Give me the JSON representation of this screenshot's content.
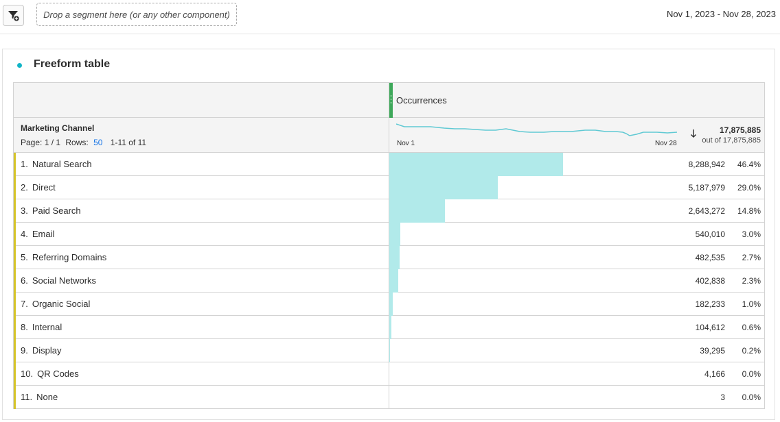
{
  "toolbar": {
    "filter_icon": "segment-filter-add-icon",
    "drop_zone_text": "Drop a segment here (or any other component)",
    "date_range": "Nov 1, 2023 - Nov 28, 2023"
  },
  "panel": {
    "title": "Freeform table",
    "metric": {
      "name": "Occurrences",
      "total": "17,875,885",
      "total_of": "out of 17,875,885",
      "sparkline_start": "Nov 1",
      "sparkline_end": "Nov 28",
      "sort_icon": "sort-descending-icon"
    },
    "dimension": {
      "name": "Marketing Channel",
      "page_label": "Page: 1 / 1",
      "rows_label": "Rows:",
      "rows_value": "50",
      "range": "1-11 of 11"
    },
    "rows": [
      {
        "num": "1.",
        "label": "Natural Search",
        "value": "8,288,942",
        "pct": "46.4%",
        "share": 0.464
      },
      {
        "num": "2.",
        "label": "Direct",
        "value": "5,187,979",
        "pct": "29.0%",
        "share": 0.29
      },
      {
        "num": "3.",
        "label": "Paid Search",
        "value": "2,643,272",
        "pct": "14.8%",
        "share": 0.148
      },
      {
        "num": "4.",
        "label": "Email",
        "value": "540,010",
        "pct": "3.0%",
        "share": 0.03
      },
      {
        "num": "5.",
        "label": "Referring Domains",
        "value": "482,535",
        "pct": "2.7%",
        "share": 0.027
      },
      {
        "num": "6.",
        "label": "Social Networks",
        "value": "402,838",
        "pct": "2.3%",
        "share": 0.023
      },
      {
        "num": "7.",
        "label": "Organic Social",
        "value": "182,233",
        "pct": "1.0%",
        "share": 0.01
      },
      {
        "num": "8.",
        "label": "Internal",
        "value": "104,612",
        "pct": "0.6%",
        "share": 0.006
      },
      {
        "num": "9.",
        "label": "Display",
        "value": "39,295",
        "pct": "0.2%",
        "share": 0.002
      },
      {
        "num": "10.",
        "label": "QR Codes",
        "value": "4,166",
        "pct": "0.0%",
        "share": 0.0002
      },
      {
        "num": "11.",
        "label": "None",
        "value": "3",
        "pct": "0.0%",
        "share": 0.0
      }
    ]
  },
  "colors": {
    "bar": "#b1eaea",
    "row_accent": "#d6c52b",
    "metric_handle": "#3ea85a",
    "panel_dot": "#12b5c7",
    "link": "#1473e6"
  }
}
